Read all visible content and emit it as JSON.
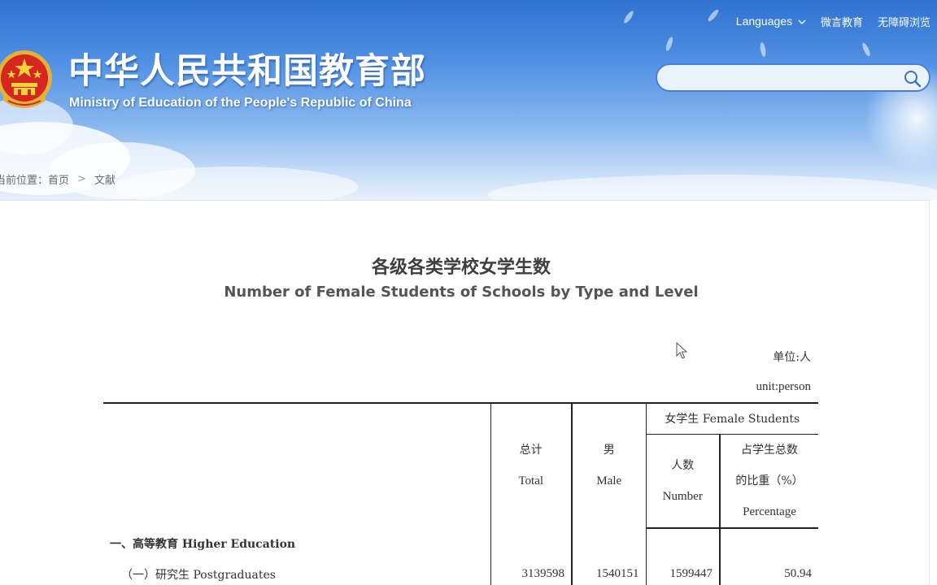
{
  "header": {
    "title": "中华人民共和国教育部",
    "subtitle": "Ministry of Education of the People's Republic of China",
    "nav": {
      "languages": "Languages",
      "weiyan": "微言教育",
      "accessible": "无障碍浏览"
    },
    "search": {
      "value": "",
      "placeholder": ""
    }
  },
  "breadcrumb": {
    "prefix": "当前位置：",
    "home": "首页",
    "separator": ">",
    "current": "文献"
  },
  "document": {
    "title_cn": "各级各类学校女学生数",
    "title_en": "Number of Female Students of Schools by Type and Level",
    "unit_cn": "单位:人",
    "unit_en": "unit:person"
  },
  "table": {
    "headers": {
      "total_cn": "总计",
      "total_en": "Total",
      "male_cn": "男",
      "male_en": "Male",
      "female_group": "女学生 Female Students",
      "number_cn": "人数",
      "number_en": "Number",
      "pct_cn_1": "占学生总数",
      "pct_cn_2": "的比重（%）",
      "pct_en": "Percentage"
    },
    "rows": [
      {
        "label": "一、高等教育 Higher Education",
        "total": "",
        "male": "",
        "female": "",
        "pct": ""
      },
      {
        "label": "（一）研究生 Postgraduates",
        "total": "3139598",
        "male": "1540151",
        "female": "1599447",
        "pct": "50.94"
      }
    ]
  },
  "colors": {
    "banner_top": "#2f72d1",
    "banner_bottom": "#e8f1fb",
    "search_border": "#4a7ed3",
    "text_dark": "#333333"
  }
}
